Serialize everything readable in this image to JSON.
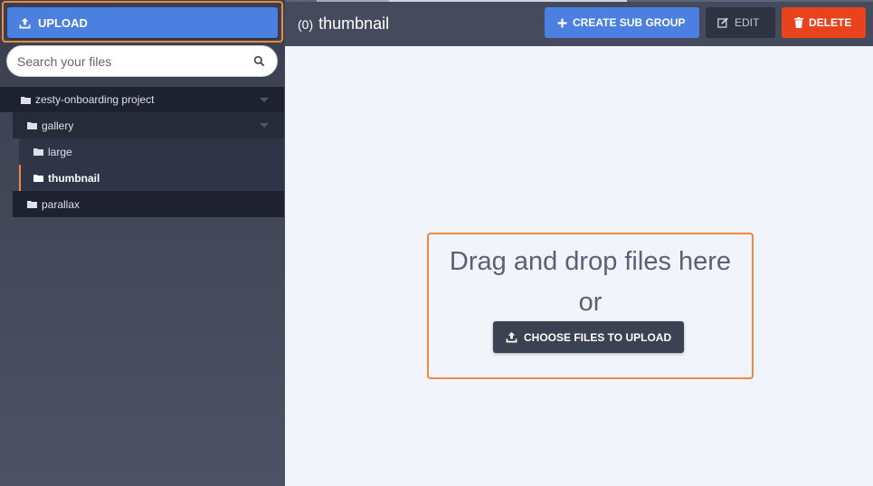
{
  "sidebar": {
    "upload_label": "UPLOAD",
    "search": {
      "placeholder": "Search your files"
    },
    "tree": {
      "root": "zesty-onboarding project",
      "gallery": "gallery",
      "large": "large",
      "thumbnail": "thumbnail",
      "parallax": "parallax"
    }
  },
  "header": {
    "count": "(0)",
    "title": "thumbnail",
    "create_label": "CREATE SUB GROUP",
    "edit_label": "EDIT",
    "delete_label": "DELETE"
  },
  "dropzone": {
    "line1": "Drag and drop files here",
    "line2": "or",
    "choose_label": "CHOOSE FILES TO UPLOAD"
  },
  "colors": {
    "accent_blue": "#4b7fe0",
    "highlight_orange": "#f0883e",
    "danger_red": "#e8431c",
    "sidebar_dark": "#1e2230"
  },
  "icons": [
    "upload-icon",
    "search-icon",
    "folder-icon",
    "plus-icon",
    "edit-icon",
    "trash-icon",
    "caret-down-icon"
  ]
}
